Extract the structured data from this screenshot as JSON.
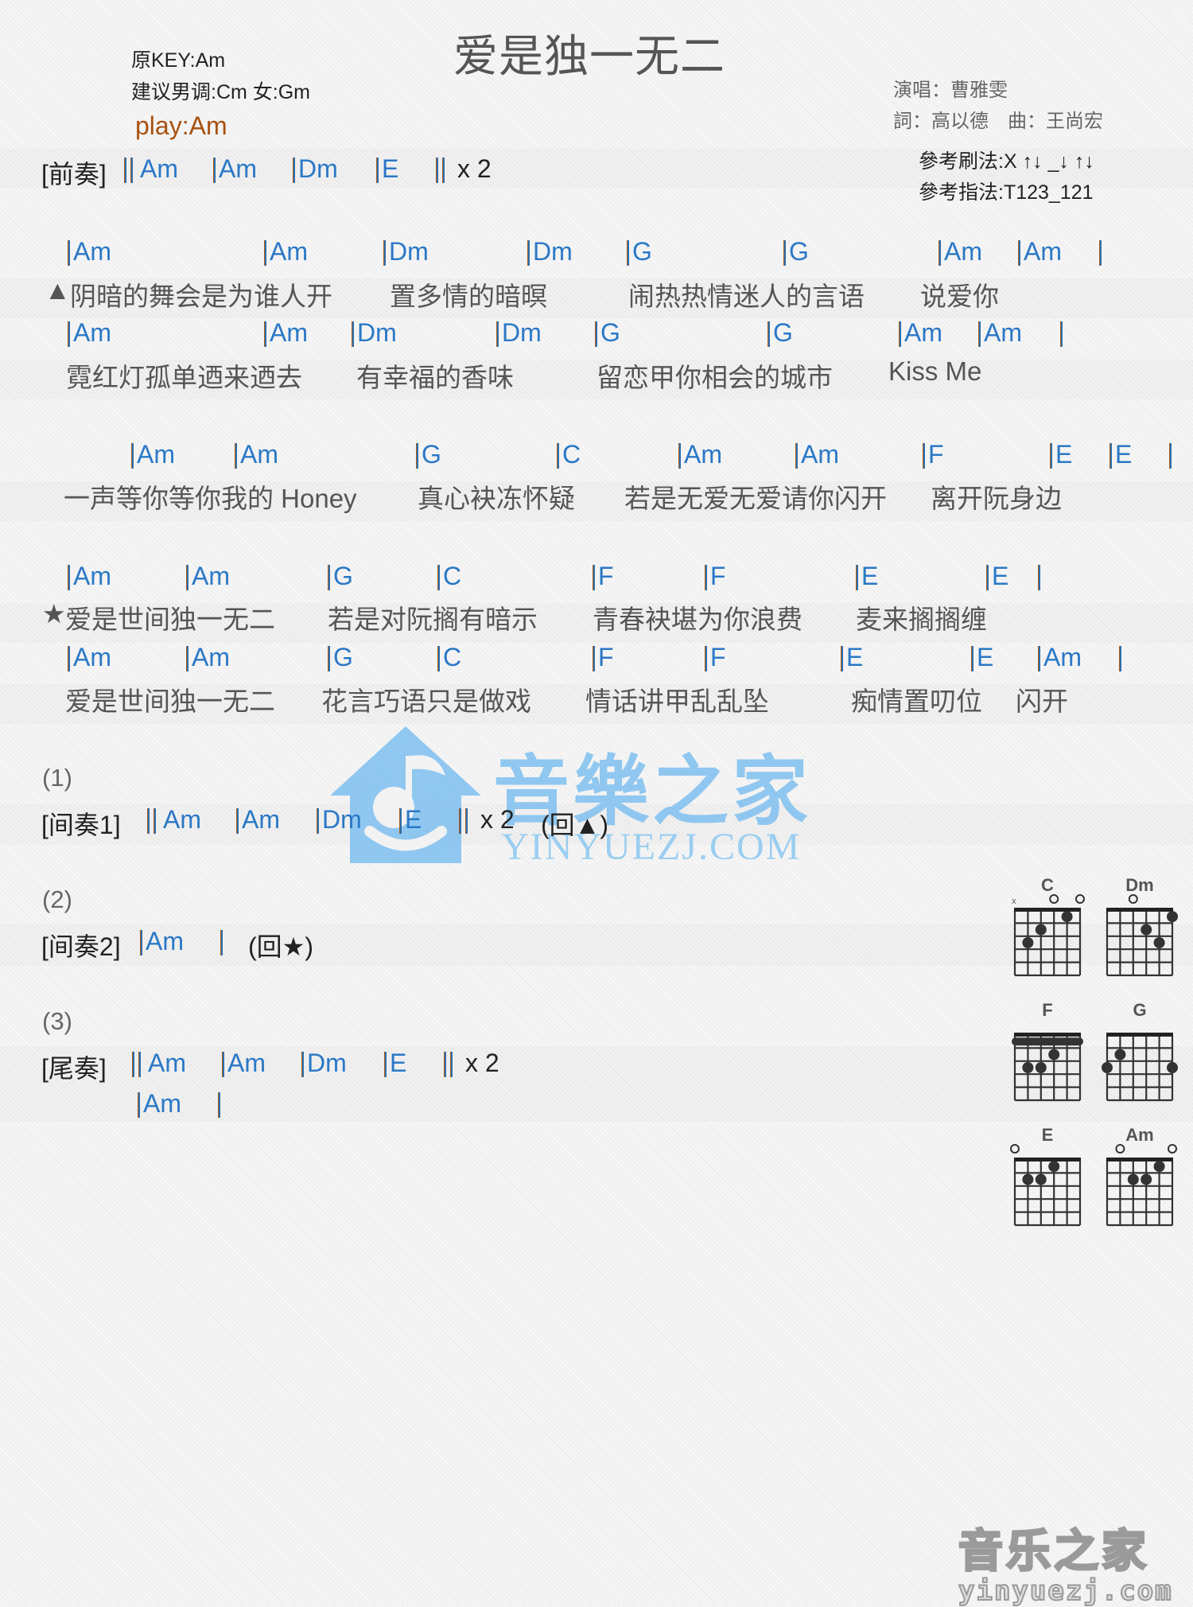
{
  "song": {
    "title": "爱是独一无二",
    "original_key": "原KEY:Am",
    "suggested_key": "建议男调:Cm 女:Gm",
    "play_key": "play:Am",
    "singer": "演唱：曹雅雯",
    "credits": "詞：高以德　曲：王尚宏",
    "strum_pattern": "參考刷法:X ↑↓ _↓ ↑↓",
    "finger_pattern": "參考指法:T123_121"
  },
  "prelude": {
    "label": "[前奏]",
    "chords": [
      "Am",
      "Am",
      "Dm",
      "E"
    ],
    "repeat": "x 2"
  },
  "verse": [
    {
      "chords": [
        "Am",
        "Am",
        "Dm",
        "Dm",
        "G",
        "G",
        "Am",
        "Am"
      ],
      "marker": "▲",
      "lyrics": [
        "阴暗的舞会是为谁人开",
        "置多情的暗暝",
        "闹热热情迷人的言语",
        "说爱你"
      ]
    },
    {
      "chords": [
        "Am",
        "Am",
        "Dm",
        "Dm",
        "G",
        "G",
        "Am",
        "Am"
      ],
      "lyrics": [
        "霓红灯孤单迺来迺去",
        "有幸福的香味",
        "留恋甲你相会的城市",
        "Kiss Me"
      ]
    }
  ],
  "bridge": {
    "chords": [
      "Am",
      "Am",
      "G",
      "C",
      "Am",
      "Am",
      "F",
      "E",
      "E"
    ],
    "lyrics": [
      "一声等你等你我的 Honey",
      "真心袂冻怀疑",
      "若是无爱无爱请你闪开",
      "离开阮身边"
    ]
  },
  "chorus": [
    {
      "chords": [
        "Am",
        "Am",
        "G",
        "C",
        "F",
        "F",
        "E",
        "E"
      ],
      "marker": "★",
      "lyrics": [
        "爱是世间独一无二",
        "若是对阮搁有暗示",
        "青春袂堪为你浪费",
        "麦来搁搁缠"
      ]
    },
    {
      "chords": [
        "Am",
        "Am",
        "G",
        "C",
        "F",
        "F",
        "E",
        "E",
        "Am"
      ],
      "lyrics": [
        "爱是世间独一无二",
        "花言巧语只是做戏",
        "情话讲甲乱乱坠",
        "痴情置叨位",
        "闪开"
      ]
    }
  ],
  "interlude1": {
    "number": "(1)",
    "label": "[间奏1]",
    "chords": [
      "Am",
      "Am",
      "Dm",
      "E"
    ],
    "repeat": "x 2",
    "return": "(回▲)"
  },
  "interlude2": {
    "number": "(2)",
    "label": "[间奏2]",
    "chords": [
      "Am"
    ],
    "return": "(回★)"
  },
  "outro": {
    "number": "(3)",
    "label": "[尾奏]",
    "chords": [
      "Am",
      "Am",
      "Dm",
      "E"
    ],
    "repeat": "x 2",
    "final_chords": [
      "Am"
    ]
  },
  "chord_diagrams": [
    {
      "name": "C",
      "muted": [
        6
      ],
      "open": [
        3,
        1
      ],
      "dots": [
        [
          5,
          3
        ],
        [
          4,
          2
        ],
        [
          2,
          1
        ]
      ],
      "barre": null
    },
    {
      "name": "Dm",
      "muted": [],
      "open": [
        4
      ],
      "dots": [
        [
          1,
          1
        ],
        [
          3,
          2
        ],
        [
          2,
          3
        ]
      ],
      "barre": null
    },
    {
      "name": "F",
      "muted": [],
      "open": [],
      "dots": [
        [
          3,
          2
        ],
        [
          5,
          3
        ],
        [
          4,
          3
        ]
      ],
      "barre": 1
    },
    {
      "name": "G",
      "muted": [],
      "open": [],
      "dots": [
        [
          5,
          2
        ],
        [
          6,
          3
        ],
        [
          1,
          3
        ]
      ],
      "barre": null
    },
    {
      "name": "E",
      "muted": [],
      "open": [
        6
      ],
      "dots": [
        [
          3,
          1
        ],
        [
          5,
          2
        ],
        [
          4,
          2
        ]
      ],
      "barre": null
    },
    {
      "name": "Am",
      "muted": [],
      "open": [
        5,
        1
      ],
      "dots": [
        [
          2,
          1
        ],
        [
          4,
          2
        ],
        [
          3,
          2
        ]
      ],
      "barre": null
    }
  ],
  "watermark": {
    "text": "音樂之家",
    "url": "YINYUEZJ.COM"
  },
  "footer_logo": {
    "text": "音乐之家",
    "url": "yinyuezj.com"
  },
  "colors": {
    "chord": "#2a78c6",
    "play_key": "#a8510f",
    "watermark": "#7fc0f0"
  }
}
